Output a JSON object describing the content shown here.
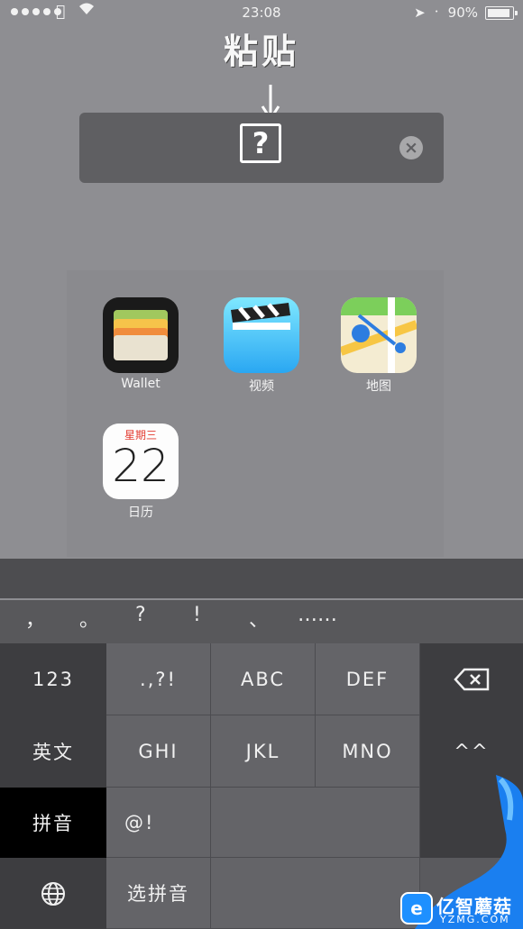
{
  "status": {
    "time": "23:08",
    "battery": "90%",
    "signal_dots": 5
  },
  "annotation": {
    "caption": "粘贴"
  },
  "search": {
    "unknown_char": "?"
  },
  "apps": [
    {
      "label": "Wallet",
      "icon": "wallet-icon"
    },
    {
      "label": "视频",
      "icon": "videos-icon"
    },
    {
      "label": "地图",
      "icon": "maps-icon"
    },
    {
      "label": "日历",
      "icon": "calendar-icon",
      "weekday": "星期三",
      "day": "22"
    }
  ],
  "keyboard": {
    "punctuation": [
      "，",
      "。",
      "?",
      "!",
      "、",
      "……"
    ],
    "rows": [
      [
        "123",
        ".,?!",
        "ABC",
        "DEF",
        "⌫"
      ],
      [
        "英文",
        "GHI",
        "JKL",
        "MNO",
        "^^"
      ],
      [
        "拼音",
        "@!",
        "",
        "",
        ""
      ],
      [
        "🌐",
        "选拼音",
        "",
        "",
        ""
      ]
    ],
    "active_mode": "拼音"
  },
  "watermark": {
    "badge": "e",
    "title": "亿智蘑菇",
    "subtitle": "YZMG.COM"
  },
  "colors": {
    "background": "#8e8e92",
    "search_field": "#5f5f62",
    "keyboard": "#5a5a5e",
    "accent": "#1e90ff"
  }
}
